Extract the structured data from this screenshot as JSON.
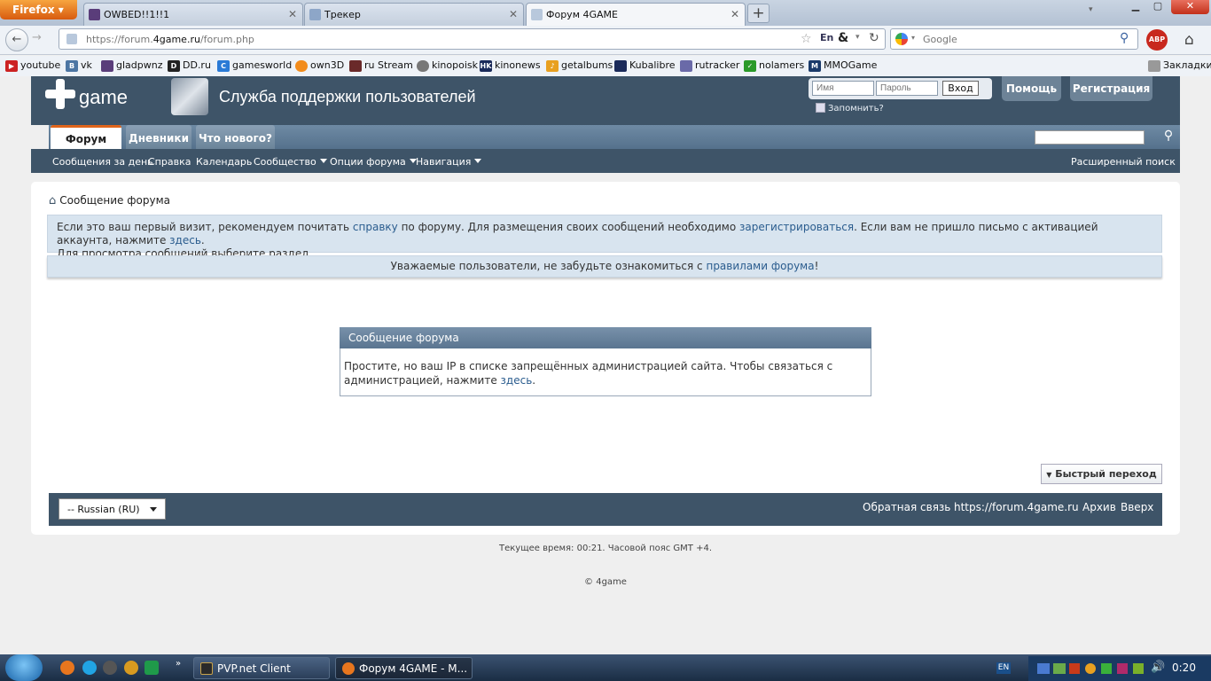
{
  "browser": {
    "menu_label": "Firefox",
    "tabs": [
      {
        "title": "OWBED!!1!!1"
      },
      {
        "title": "Трекер"
      },
      {
        "title": "Форум 4GAME"
      }
    ],
    "url_prefix": "https://forum.",
    "url_domain": "4game.ru",
    "url_path": "/forum.php",
    "search_placeholder": "Google",
    "bookmarks_menu": "Закладки",
    "bookmarks": [
      {
        "label": "youtube"
      },
      {
        "label": "vk"
      },
      {
        "label": "gladpwnz"
      },
      {
        "label": "DD.ru"
      },
      {
        "label": "gamesworld"
      },
      {
        "label": "own3D"
      },
      {
        "label": "ru Stream"
      },
      {
        "label": "kinopoisk"
      },
      {
        "label": "kinonews"
      },
      {
        "label": "getalbums"
      },
      {
        "label": "Kubalibre"
      },
      {
        "label": "rutracker"
      },
      {
        "label": "nolamers"
      },
      {
        "label": "MMOGame"
      }
    ]
  },
  "site": {
    "logo_text": "game",
    "title": "Служба поддержки пользователей",
    "login": {
      "username_placeholder": "Имя",
      "password_placeholder": "Пароль",
      "submit": "Вход",
      "remember": "Запомнить?"
    },
    "help_button": "Помощь",
    "register_button": "Регистрация",
    "tabs": [
      {
        "label": "Форум"
      },
      {
        "label": "Дневники"
      },
      {
        "label": "Что нового?"
      }
    ],
    "subnav": [
      {
        "label": "Сообщения за день"
      },
      {
        "label": "Справка"
      },
      {
        "label": "Календарь"
      },
      {
        "label": "Сообщество"
      },
      {
        "label": "Опции форума"
      },
      {
        "label": "Навигация"
      }
    ],
    "advanced_search": "Расширенный поиск"
  },
  "breadcrumb": "Сообщение форума",
  "notice1": {
    "t1": "Если это ваш первый визит, рекомендуем почитать ",
    "l1": "справку",
    "t2": " по форуму. Для размещения своих сообщений необходимо ",
    "l2": "зарегистрироваться",
    "t3": ". Если вам не пришло письмо с активацией аккаунта, нажмите ",
    "l3": "здесь",
    "t4": ".",
    "line2": "Для просмотра сообщений выберите раздел."
  },
  "notice2": {
    "t1": "Уважаемые пользователи, не забудьте ознакомиться с ",
    "link": "правилами форума",
    "t2": "!"
  },
  "message": {
    "title": "Сообщение форума",
    "line1": "Простите, но ваш IP в списке запрещённых администрацией сайта. Чтобы связаться с",
    "line2_prefix": "администрацией, нажмите ",
    "link": "здесь",
    "line2_suffix": "."
  },
  "quick_nav": "Быстрый переход",
  "footer": {
    "language": "-- Russian (RU)",
    "links": [
      {
        "label": "Обратная связь"
      },
      {
        "label": "https://forum.4game.ru"
      },
      {
        "label": "Архив"
      },
      {
        "label": "Вверх"
      }
    ]
  },
  "current_time": "Текущее время: 00:21. Часовой пояс GMT +4.",
  "copyright": "© 4game",
  "taskbar": {
    "items": [
      {
        "label": "PVP.net Client"
      },
      {
        "label": "Форум 4GAME - M..."
      }
    ],
    "lang": "EN",
    "clock": "0:20"
  },
  "colors": {
    "header_bg": "#3e5468",
    "notice_bg": "#d8e4ef",
    "link": "#2a5c8e",
    "active_tab_accent": "#e0651b"
  }
}
